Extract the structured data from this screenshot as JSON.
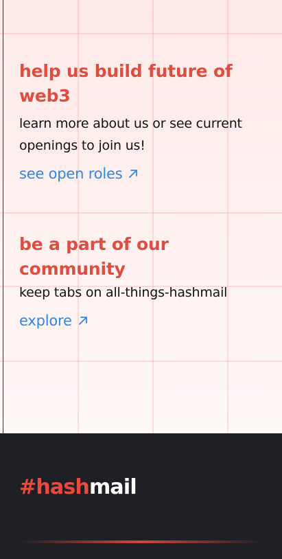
{
  "sections": {
    "careers": {
      "title": "help us build future of web3",
      "description": "learn more about us or see current openings to join us!",
      "link_label": "see open roles"
    },
    "community": {
      "title": "be a part of our community",
      "description": "keep tabs on all-things-hashmail",
      "link_label": "explore"
    }
  },
  "footer": {
    "logo_part1": "#hash",
    "logo_part2": "mail"
  },
  "colors": {
    "accent_red": "#dd4d40",
    "link_blue": "#2b87e8",
    "footer_bg": "#1f2026"
  },
  "icons": {
    "link_arrow": "arrow-up-right-icon"
  }
}
